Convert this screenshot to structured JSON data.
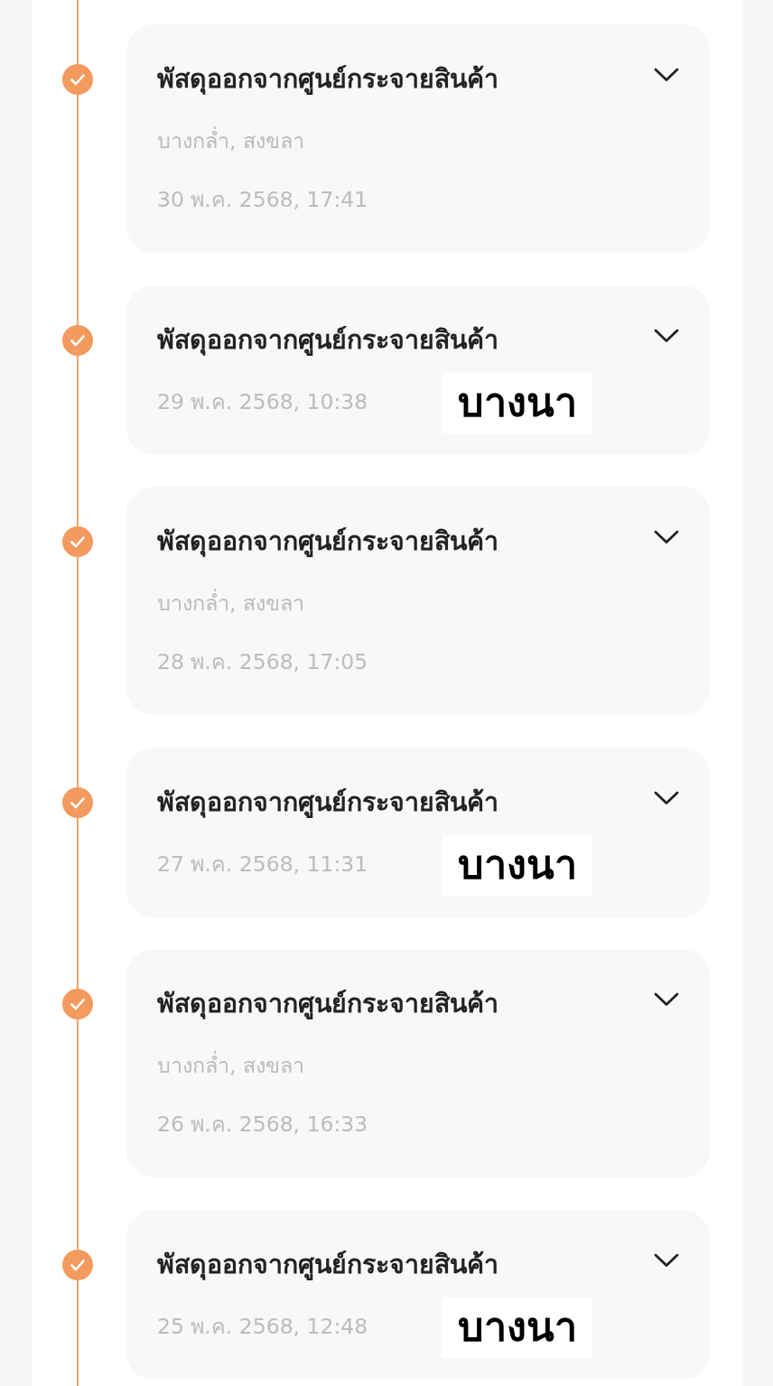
{
  "timeline": {
    "events": [
      {
        "status": "พัสดุออกจากศูนย์กระจายสินค้า",
        "location": "บางกล่ำ, สงขลา",
        "time": "30 พ.ค. 2568, 17:41",
        "completed": true,
        "expanded": false
      },
      {
        "status": "พัสดุออกจากศูนย์กระจายสินค้า",
        "time": "29 พ.ค. 2568, 10:38",
        "completed": true,
        "expanded": false,
        "overlay_label": "บางนา"
      },
      {
        "status": "พัสดุออกจากศูนย์กระจายสินค้า",
        "location": "บางกล่ำ, สงขลา",
        "time": "28 พ.ค. 2568, 17:05",
        "completed": true,
        "expanded": false
      },
      {
        "status": "พัสดุออกจากศูนย์กระจายสินค้า",
        "time": "27 พ.ค. 2568, 11:31",
        "completed": true,
        "expanded": false,
        "overlay_label": "บางนา"
      },
      {
        "status": "พัสดุออกจากศูนย์กระจายสินค้า",
        "location": "บางกล่ำ, สงขลา",
        "time": "26 พ.ค. 2568, 16:33",
        "completed": true,
        "expanded": false
      },
      {
        "status": "พัสดุออกจากศูนย์กระจายสินค้า",
        "time": "25 พ.ค. 2568, 12:48",
        "completed": true,
        "expanded": false,
        "overlay_label": "บางนา"
      }
    ]
  }
}
